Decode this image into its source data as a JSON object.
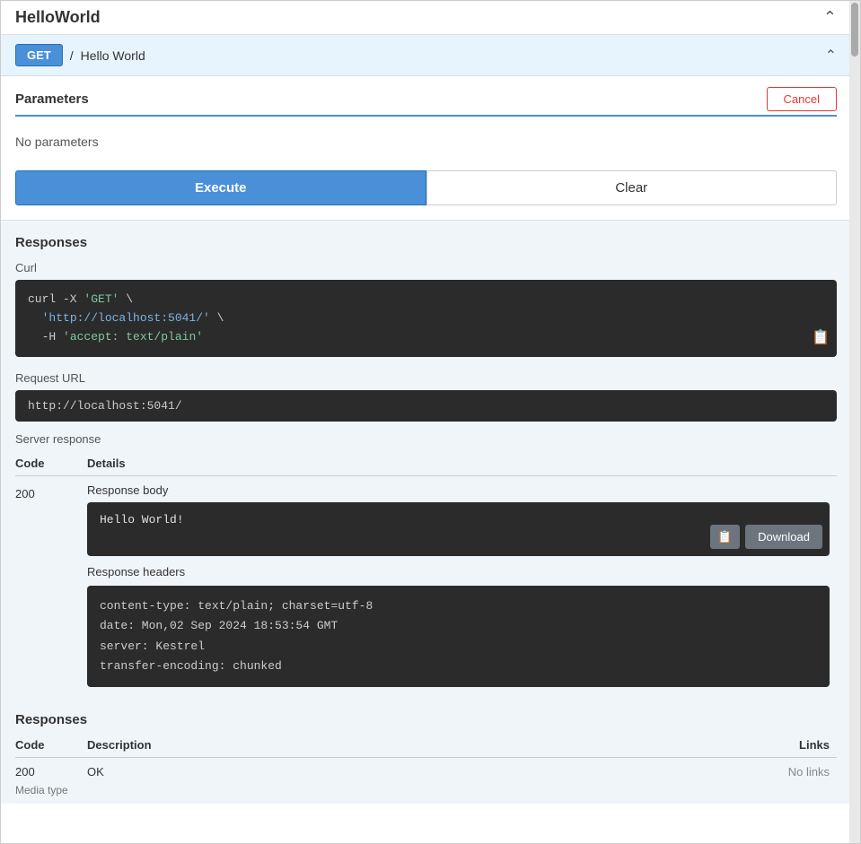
{
  "window": {
    "title": "HelloWorld",
    "close_icon": "chevron-up"
  },
  "endpoint": {
    "method": "GET",
    "separator": "/",
    "path": "Hello World",
    "collapse_icon": "chevron-up"
  },
  "parameters": {
    "label": "Parameters",
    "cancel_button": "Cancel",
    "no_parameters_text": "No parameters",
    "execute_button": "Execute",
    "clear_button": "Clear"
  },
  "responses_section": {
    "label": "Responses"
  },
  "curl": {
    "label": "Curl",
    "line1": "curl -X 'GET' \\",
    "line2": "  'http://localhost:5041/' \\",
    "line3": "  -H 'accept: text/plain'"
  },
  "request_url": {
    "label": "Request URL",
    "value": "http://localhost:5041/"
  },
  "server_response": {
    "label": "Server response",
    "col_code": "Code",
    "col_details": "Details",
    "code": "200",
    "response_body_label": "Response body",
    "response_body_value": "Hello World!",
    "response_headers_label": "Response headers",
    "response_headers_line1": "content-type: text/plain; charset=utf-8",
    "response_headers_line2": "date: Mon,02 Sep 2024 18:53:54 GMT",
    "response_headers_line3": "server: Kestrel",
    "response_headers_line4": "transfer-encoding: chunked",
    "download_button": "Download"
  },
  "responses_desc": {
    "label": "Responses",
    "col_code": "Code",
    "col_description": "Description",
    "col_links": "Links",
    "code": "200",
    "description": "OK",
    "links": "No links",
    "media_type": "Media type"
  }
}
